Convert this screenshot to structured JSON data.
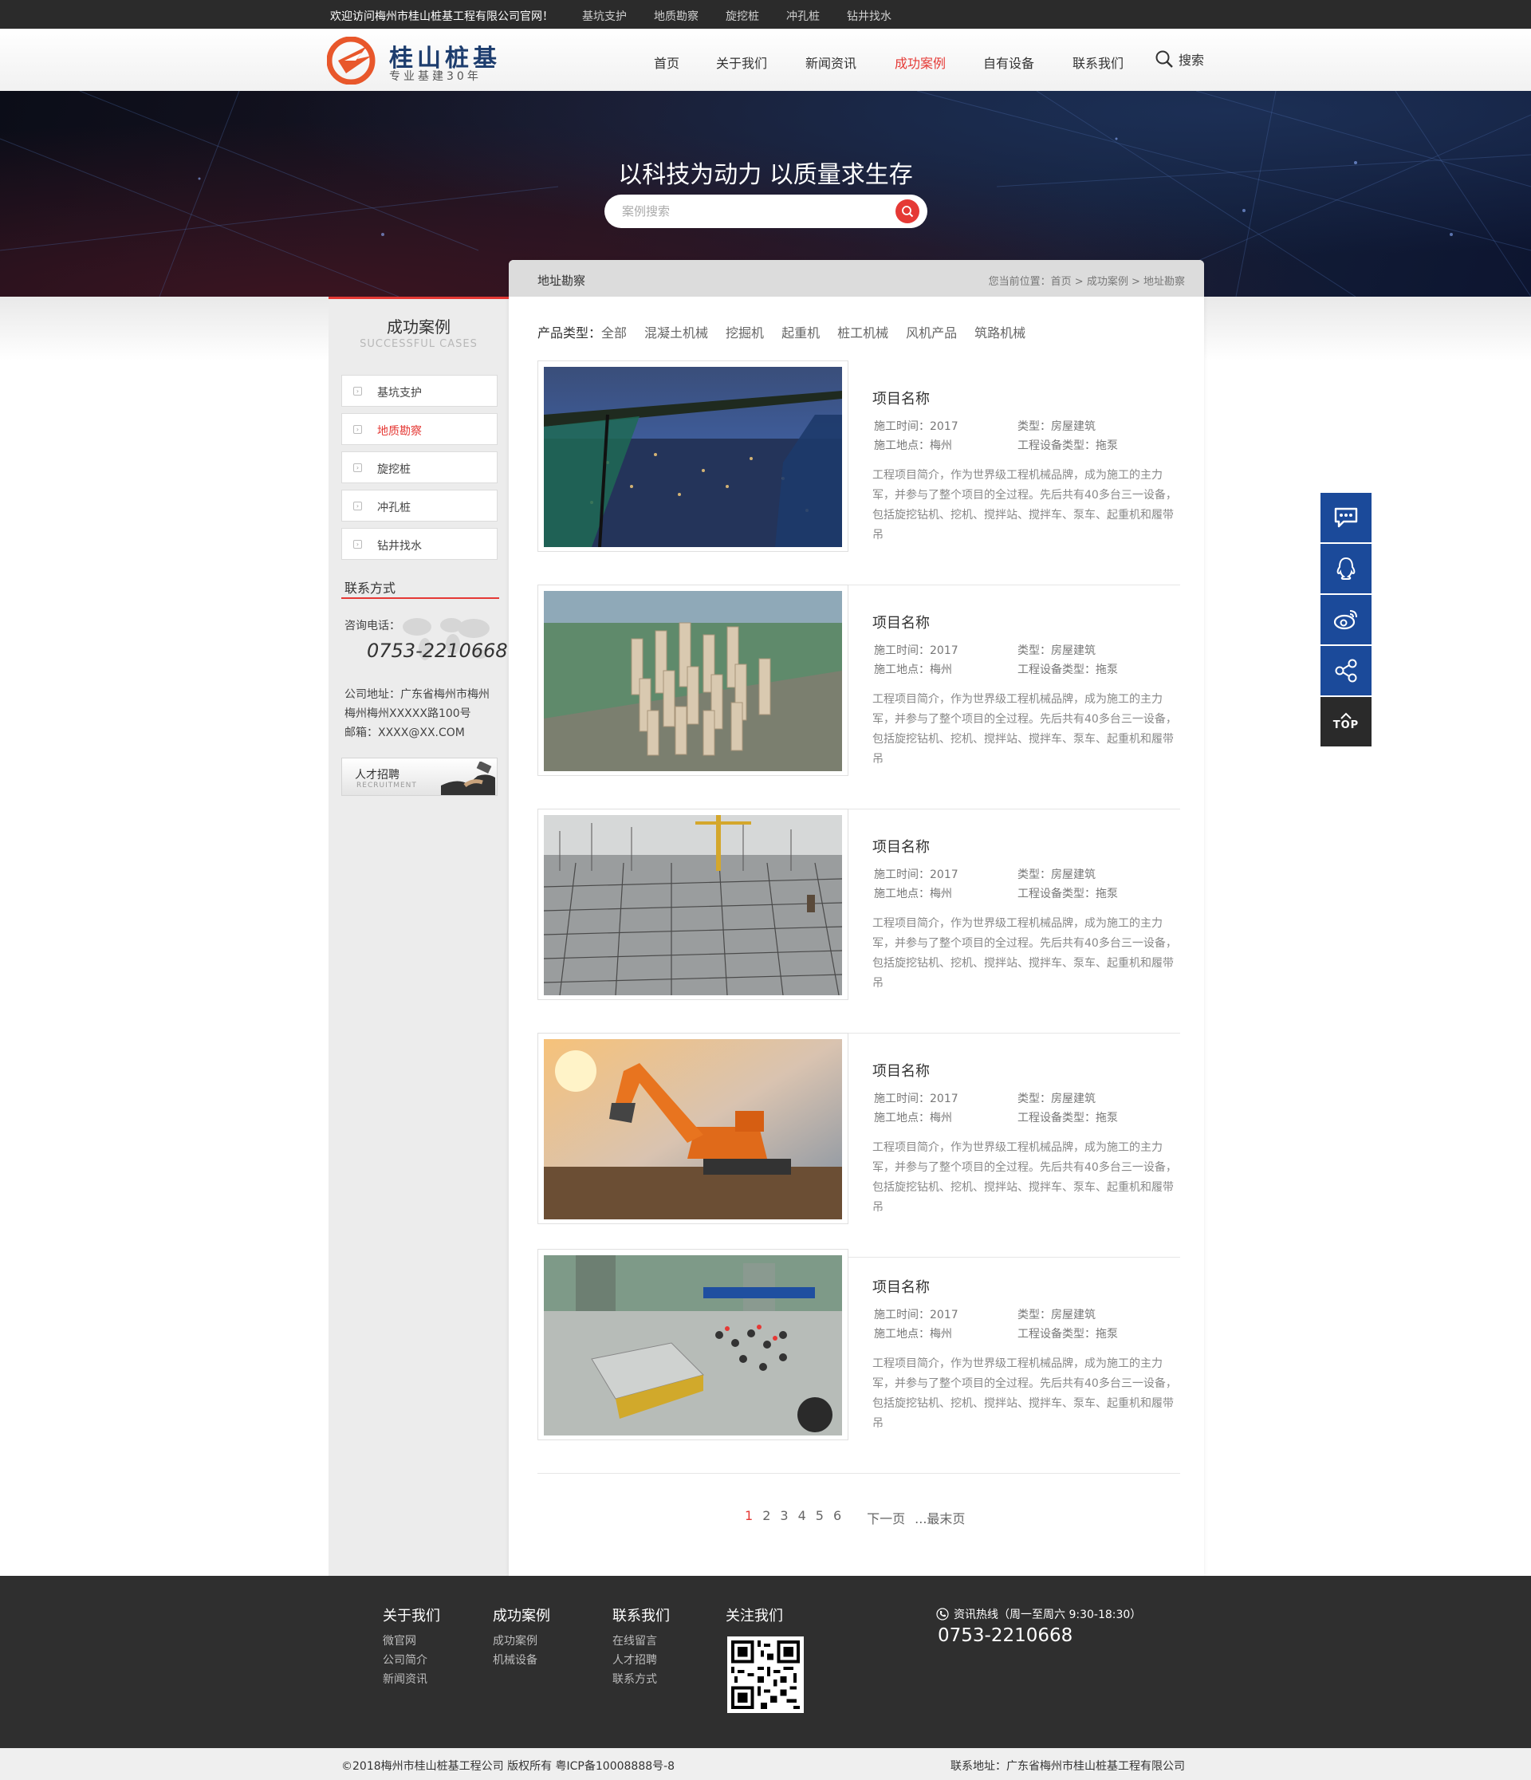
{
  "topbar": {
    "welcome": "欢迎访问梅州市桂山桩基工程有限公司官网！",
    "quick_links": [
      "基坑支护",
      "地质勘察",
      "旋挖桩",
      "冲孔桩",
      "钻井找水"
    ]
  },
  "header": {
    "logo_name": "桂山桩基",
    "logo_slogan": "专业基建30年",
    "nav": [
      "首页",
      "关于我们",
      "新闻资讯",
      "成功案例",
      "自有设备",
      "联系我们"
    ],
    "nav_active": "成功案例",
    "search_label": "搜索",
    "accent_color": "#e53935",
    "brand_color": "#1d3d6e"
  },
  "banner": {
    "title": "以科技为动力 以质量求生存",
    "search_placeholder": "案例搜索"
  },
  "sidebar": {
    "title": "成功案例",
    "subtitle": "SUCCESSFUL CASES",
    "items": [
      {
        "label": "基坑支护",
        "active": false
      },
      {
        "label": "地质勘察",
        "active": true
      },
      {
        "label": "旋挖桩",
        "active": false
      },
      {
        "label": "冲孔桩",
        "active": false
      },
      {
        "label": "钻井找水",
        "active": false
      }
    ],
    "contact": {
      "heading": "联系方式",
      "phone_label": "咨询电话：",
      "phone": "0753-2210668",
      "address_1": "公司地址：广东省梅州市梅州",
      "address_2": "梅州梅州XXXXX路100号",
      "email": "邮箱：XXXX@XX.COM"
    },
    "recruit": {
      "title": "人才招聘",
      "subtitle": "RECRUITMENT"
    }
  },
  "main": {
    "category": "地址勘察",
    "breadcrumb": "您当前位置：首页 > 成功案例 > 地址勘察",
    "filter_label": "产品类型：",
    "filters": [
      "全部",
      "混凝土机械",
      "挖掘机",
      "起重机",
      "桩工机械",
      "风机产品",
      "筑路机械"
    ],
    "cases": [
      {
        "name": "项目名称",
        "time": "施工时间：2017",
        "type": "类型：房屋建筑",
        "place": "施工地点：梅州",
        "equip": "工程设备类型：拖泵",
        "intro": "工程项目简介，作为世界级工程机械品牌，成为施工的主力军，并参与了整个项目的全过程。先后共有40多台三一设备，包括旋挖钻机、挖机、搅拌站、搅拌车、泵车、起重机和履带吊",
        "image": "city-night-view"
      },
      {
        "name": "项目名称",
        "time": "施工时间：2017",
        "type": "类型：房屋建筑",
        "place": "施工地点：梅州",
        "equip": "工程设备类型：拖泵",
        "intro": "工程项目简介，作为世界级工程机械品牌，成为施工的主力军，并参与了整个项目的全过程。先后共有40多台三一设备，包括旋挖钻机、挖机、搅拌站、搅拌车、泵车、起重机和履带吊",
        "image": "residential-aerial"
      },
      {
        "name": "项目名称",
        "time": "施工时间：2017",
        "type": "类型：房屋建筑",
        "place": "施工地点：梅州",
        "equip": "工程设备类型：拖泵",
        "intro": "工程项目简介，作为世界级工程机械品牌，成为施工的主力军，并参与了整个项目的全过程。先后共有40多台三一设备，包括旋挖钻机、挖机、搅拌站、搅拌车、泵车、起重机和履带吊",
        "image": "rebar-foundation"
      },
      {
        "name": "项目名称",
        "time": "施工时间：2017",
        "type": "类型：房屋建筑",
        "place": "施工地点：梅州",
        "equip": "工程设备类型：拖泵",
        "intro": "工程项目简介，作为世界级工程机械品牌，成为施工的主力军，并参与了整个项目的全过程。先后共有40多台三一设备，包括旋挖钻机、挖机、搅拌站、搅拌车、泵车、起重机和履带吊",
        "image": "excavator-sunset"
      },
      {
        "name": "项目名称",
        "time": "施工时间：2017",
        "type": "类型：房屋建筑",
        "place": "施工地点：梅州",
        "equip": "工程设备类型：拖泵",
        "intro": "工程项目简介，作为世界级工程机械品牌，成为施工的主力军，并参与了整个项目的全过程。先后共有40多台三一设备，包括旋挖钻机、挖机、搅拌站、搅拌车、泵车、起重机和履带吊",
        "image": "site-inspection"
      }
    ],
    "pagination": {
      "pages": [
        "1",
        "2",
        "3",
        "4",
        "5",
        "6"
      ],
      "current": "1",
      "next": "下一页",
      "last": "...最末页"
    }
  },
  "float_tools": [
    "chat-icon",
    "qq-icon",
    "weibo-icon",
    "share-icon",
    "top-icon"
  ],
  "float_top_label": "TOP",
  "footer": {
    "columns": [
      {
        "title": "关于我们",
        "links": [
          "微官网",
          "公司简介",
          "新闻资讯"
        ]
      },
      {
        "title": "成功案例",
        "links": [
          "成功案例",
          "机械设备"
        ]
      },
      {
        "title": "联系我们",
        "links": [
          "在线留言",
          "人才招聘",
          "联系方式"
        ]
      }
    ],
    "follow_title": "关注我们",
    "hotline_label": "资讯热线（周一至周六 9:30-18:30）",
    "hotline": "0753-2210668",
    "copyright": "©2018梅州市桂山桩基工程公司 版权所有 粤ICP备10008888号-8",
    "address": "联系地址：广东省梅州市桂山桩基工程有限公司"
  }
}
